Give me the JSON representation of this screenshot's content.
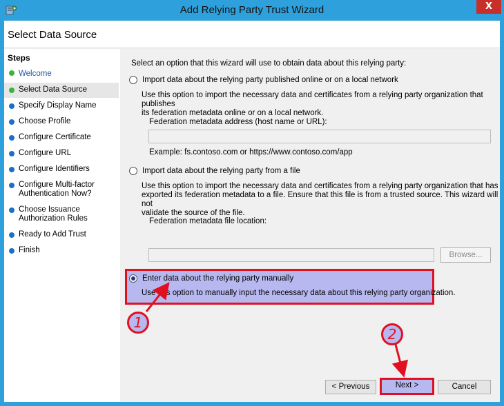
{
  "window": {
    "title": "Add Relying Party Trust Wizard",
    "close_glyph": "X",
    "icon": "wizard-app-icon"
  },
  "header": {
    "title": "Select Data Source"
  },
  "steps": {
    "title": "Steps",
    "items": [
      {
        "label": "Welcome",
        "status": "done"
      },
      {
        "label": "Select Data Source",
        "status": "current"
      },
      {
        "label": "Specify Display Name",
        "status": "pending"
      },
      {
        "label": "Choose Profile",
        "status": "pending"
      },
      {
        "label": "Configure Certificate",
        "status": "pending"
      },
      {
        "label": "Configure URL",
        "status": "pending"
      },
      {
        "label": "Configure Identifiers",
        "status": "pending"
      },
      {
        "label": "Configure Multi-factor Authentication Now?",
        "status": "pending"
      },
      {
        "label": "Choose Issuance Authorization Rules",
        "status": "pending"
      },
      {
        "label": "Ready to Add Trust",
        "status": "pending"
      },
      {
        "label": "Finish",
        "status": "pending"
      }
    ]
  },
  "content": {
    "intro": "Select an option that this wizard will use to obtain data about this relying party:",
    "option_online": {
      "label": "Import data about the relying party published online or on a local network",
      "desc_line1": "Use this option to import the necessary data and certificates from a relying party organization that publishes",
      "desc_line2": "its federation metadata online or on a local network.",
      "field_label": "Federation metadata address (host name or URL):",
      "field_value": "",
      "example": "Example: fs.contoso.com or https://www.contoso.com/app"
    },
    "option_file": {
      "label": "Import data about the relying party from a file",
      "desc_line1": "Use this option to import the necessary data and certificates from a relying party organization that has",
      "desc_line2": "exported its federation metadata to a file. Ensure that this file is from a trusted source.  This wizard will not",
      "desc_line3": "validate the source of the file.",
      "field_label": "Federation metadata file location:",
      "field_value": "",
      "browse_label": "Browse..."
    },
    "option_manual": {
      "label": "Enter data about the relying party manually",
      "desc": "Use this option to manually input the necessary data about this relying party organization.",
      "selected": true
    }
  },
  "footer": {
    "previous_label": "< Previous",
    "next_label": "Next >",
    "cancel_label": "Cancel"
  },
  "annotations": {
    "marker1": "1",
    "marker2": "2",
    "color": "#e01020",
    "fill": "#b8b8f0"
  }
}
